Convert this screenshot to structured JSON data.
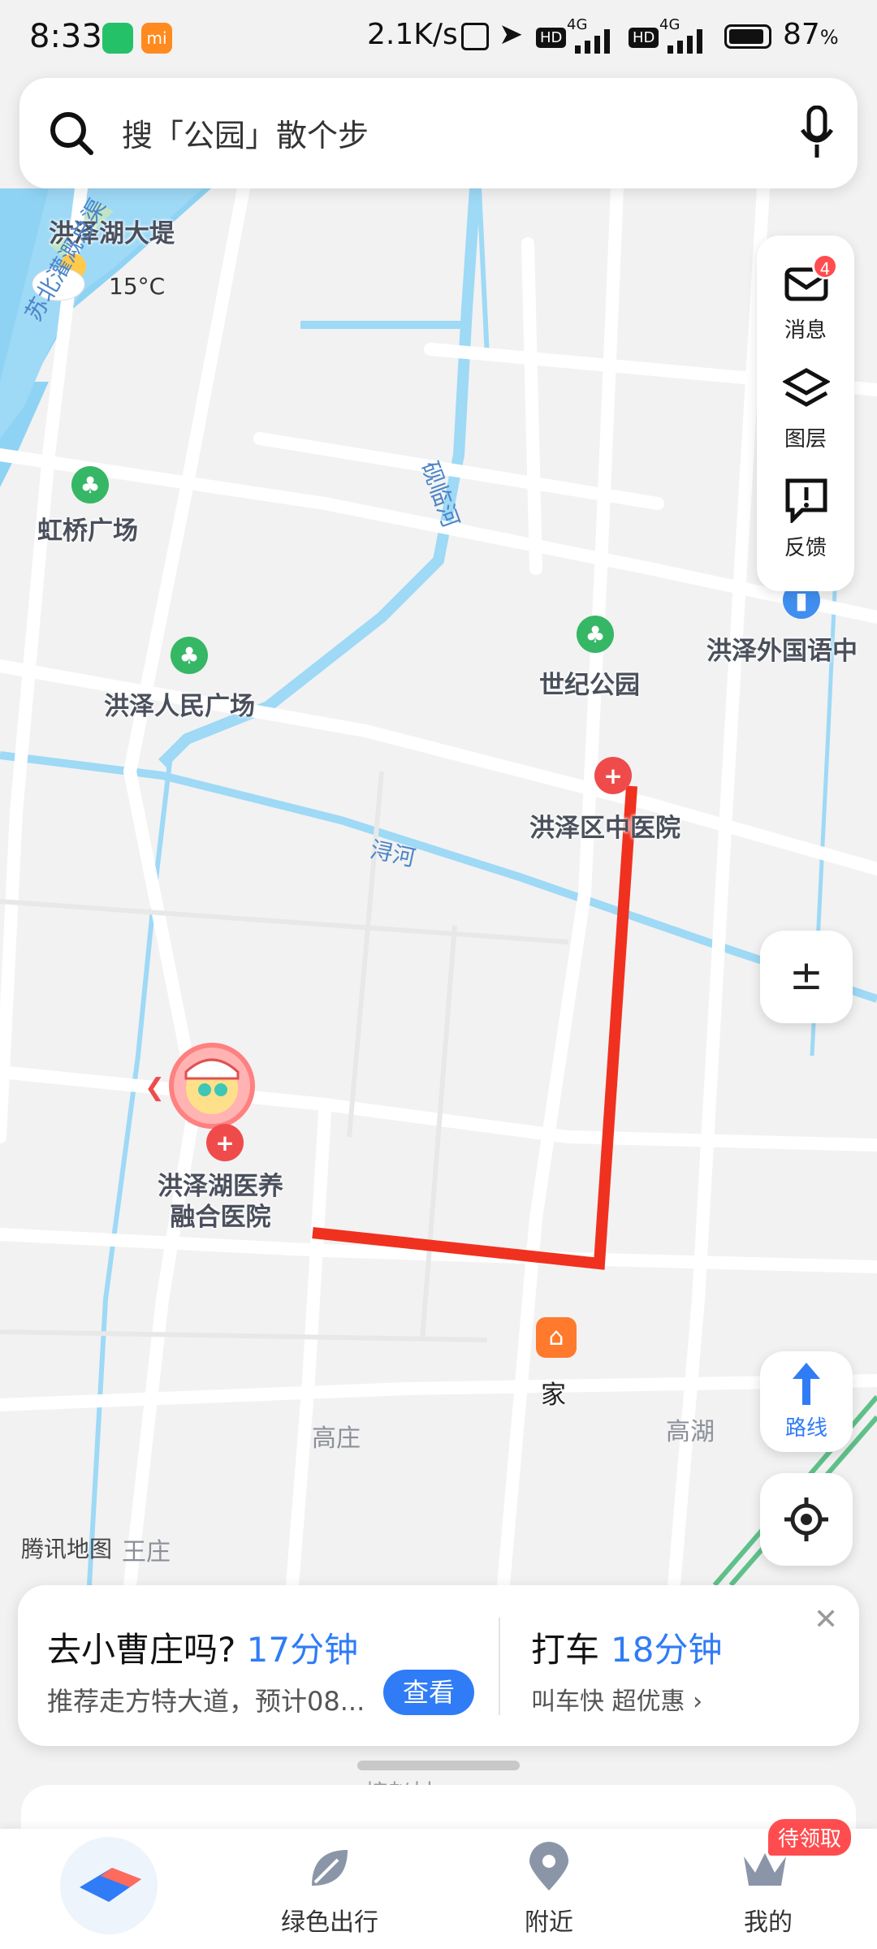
{
  "status_bar": {
    "time": "8:33",
    "network_speed": "2.1K/s",
    "sim1_type": "4G",
    "sim2_type": "4G",
    "hd1": "HD",
    "hd2": "HD",
    "battery": "87",
    "battery_unit": "%",
    "app_badge_color": "#ff8a1f",
    "green_badge_color": "#25c168"
  },
  "search": {
    "placeholder": "搜「公园」散个步"
  },
  "weather": {
    "temperature": "15°C"
  },
  "map_labels": {
    "dike": "洪泽湖大堤",
    "hongqiao_square": "虹桥广场",
    "people_square": "洪泽人民广场",
    "century_park": "世纪公园",
    "foreign_school": "洪泽外国语中",
    "hospital_district": "洪泽区中医院",
    "hospital_care_line1": "洪泽湖医养",
    "hospital_care_line2": "融合医院",
    "home": "家",
    "gaozhuang": "高庄",
    "gaohu": "高湖",
    "wangzhuang": "王庄",
    "jieyucun": "接赵村",
    "watermark": "腾讯地图",
    "river_xun": "浔河",
    "river_yanlin": "砚临河",
    "canal_north": "苏北灌溉总渠"
  },
  "tools": {
    "message_label": "消息",
    "message_count": "4",
    "layers_label": "图层",
    "feedback_label": "反馈",
    "route_label": "路线"
  },
  "suggestion": {
    "question": "去小曹庄吗?",
    "duration": "17分钟",
    "detail": "推荐走方特大道，预计08...",
    "view_button": "查看",
    "taxi_label": "打车",
    "taxi_duration": "18分钟",
    "taxi_detail": "叫车快 超优惠 ›",
    "close": "✕"
  },
  "nav": {
    "green_travel": "绿色出行",
    "nearby": "附近",
    "mine": "我的",
    "mine_badge": "待领取"
  },
  "colors": {
    "accent": "#2f7cf6",
    "route": "#f0311f",
    "water": "#8fd3f4",
    "park_pin": "#35b765",
    "hospital_pin": "#ef4b4b",
    "home_pin": "#ff7a2c"
  }
}
